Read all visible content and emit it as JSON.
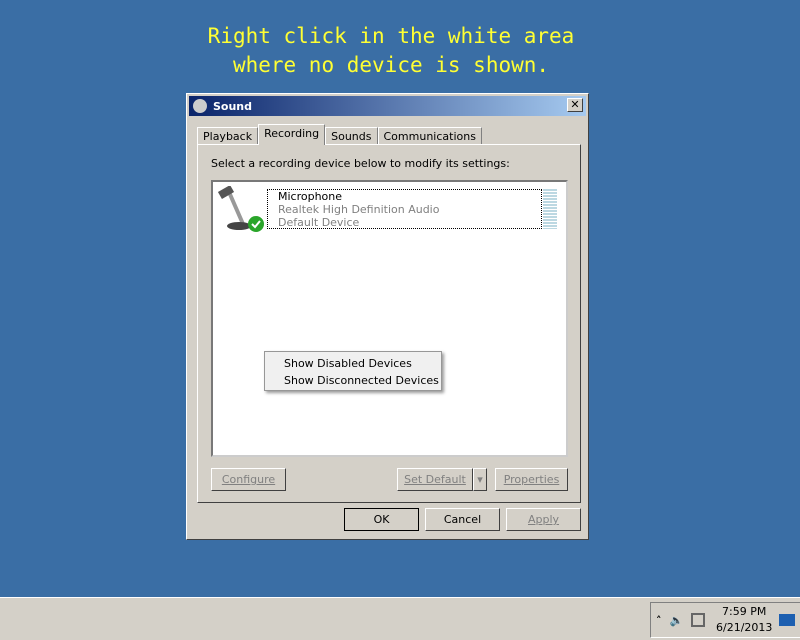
{
  "instruction": {
    "line1": "Right click in the white area",
    "line2": "where no device is shown."
  },
  "window": {
    "title": "Sound",
    "close": "✕",
    "tabs": [
      {
        "label": "Playback"
      },
      {
        "label": "Recording"
      },
      {
        "label": "Sounds"
      },
      {
        "label": "Communications"
      }
    ],
    "prompt": "Select a recording device below to modify its settings:",
    "device": {
      "name": "Microphone",
      "driver": "Realtek High Definition Audio",
      "status": "Default Device"
    },
    "context_menu": [
      "Show Disabled Devices",
      "Show Disconnected Devices"
    ],
    "buttons": {
      "configure": "Configure",
      "set_default": "Set Default",
      "properties": "Properties",
      "ok": "OK",
      "cancel": "Cancel",
      "apply": "Apply"
    }
  },
  "taskbar": {
    "time": "7:59 PM",
    "date": "6/21/2013"
  }
}
